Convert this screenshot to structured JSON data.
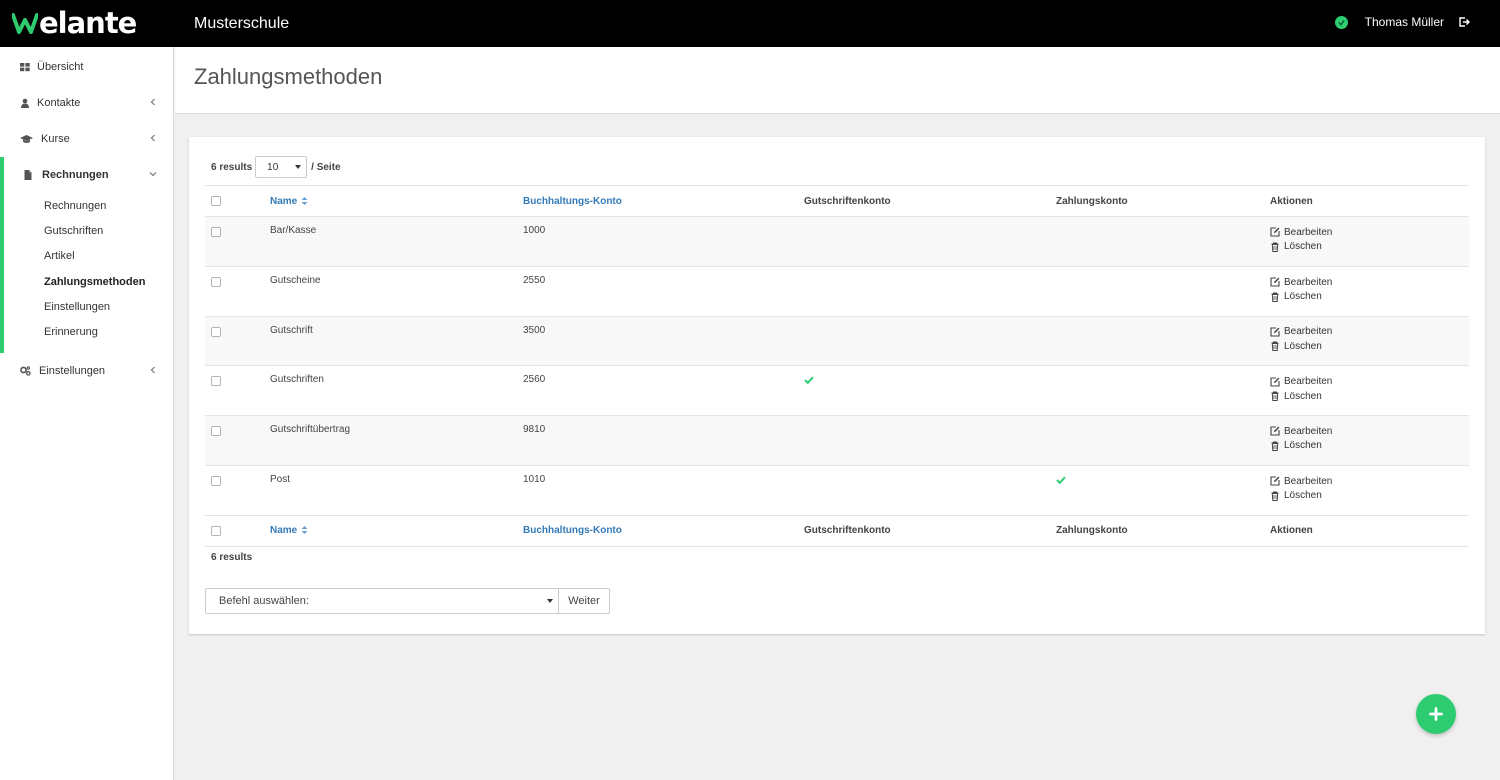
{
  "brand": {
    "logo_text": "elante",
    "school": "Musterschule"
  },
  "user": {
    "name": "Thomas Müller"
  },
  "colors": {
    "accent": "#2ecc71",
    "link": "#337ab7",
    "topbar": "#000000"
  },
  "sidebar": {
    "items": [
      {
        "label": "Übersicht",
        "icon": "dashboard-icon"
      },
      {
        "label": "Kontakte",
        "icon": "user-icon"
      },
      {
        "label": "Kurse",
        "icon": "graduation-cap-icon"
      },
      {
        "label": "Rechnungen",
        "icon": "document-icon",
        "children": [
          "Rechnungen",
          "Gutschriften",
          "Artikel",
          "Zahlungsmethoden",
          "Einstellungen",
          "Erinnerung"
        ]
      },
      {
        "label": "Einstellungen",
        "icon": "gears-icon"
      }
    ],
    "current_child": "Zahlungsmethoden"
  },
  "page": {
    "title": "Zahlungsmethoden"
  },
  "table": {
    "results_label": "6 results",
    "per_page_value": "10",
    "per_page_suffix": "/ Seite",
    "columns": [
      "Name",
      "Buchhaltungs-Konto",
      "Gutschriftenkonto",
      "Zahlungskonto",
      "Aktionen"
    ],
    "rows": [
      {
        "name": "Bar/Kasse",
        "konto": "1000",
        "gutschriftenkonto": false,
        "zahlungskonto": false
      },
      {
        "name": "Gutscheine",
        "konto": "2550",
        "gutschriftenkonto": false,
        "zahlungskonto": false
      },
      {
        "name": "Gutschrift",
        "konto": "3500",
        "gutschriftenkonto": false,
        "zahlungskonto": false
      },
      {
        "name": "Gutschriften",
        "konto": "2560",
        "gutschriftenkonto": true,
        "zahlungskonto": false
      },
      {
        "name": "Gutschriftübertrag",
        "konto": "9810",
        "gutschriftenkonto": false,
        "zahlungskonto": false
      },
      {
        "name": "Post",
        "konto": "1010",
        "gutschriftenkonto": false,
        "zahlungskonto": true
      }
    ],
    "actions": {
      "edit": "Bearbeiten",
      "delete": "Löschen"
    },
    "results_bottom": "6 results"
  },
  "bulk": {
    "select_placeholder": "Befehl auswählen:",
    "submit_label": "Weiter"
  }
}
